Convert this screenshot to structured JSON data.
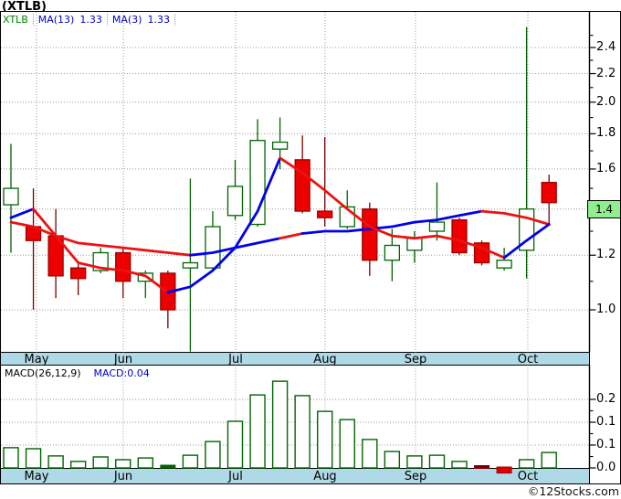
{
  "title": "(XTLB)",
  "legend": {
    "symbol": "XTLB",
    "ma13_label": "MA(13)",
    "ma13_value": "1.33",
    "ma3_label": "MA(3)",
    "ma3_value": "1.33"
  },
  "macd_panel": {
    "label": "MACD(26,12,9)",
    "value_label": "MACD:0.04"
  },
  "price_box_value": "1.4",
  "copyright": "©12Stocks.com",
  "colors": {
    "candle_up_outline": "#006400",
    "candle_down_fill": "#EE0000",
    "candle_down_stroke": "#990000",
    "candle_down_wick": "#7A0000",
    "ma_red": "#EE1111",
    "ma_blue": "#0000EE",
    "strip_blue": "#AFD9E6",
    "legend_blue": "#0000CD",
    "symbol_green": "#008000",
    "price_box_bg": "#90EE90",
    "grid_gray": "#9a9a9a"
  },
  "chart_data": [
    {
      "type": "candlestick",
      "title": "(XTLB) weekly price",
      "months": [
        "May",
        "Jun",
        "Jul",
        "Aug",
        "Sep",
        "Oct"
      ],
      "y_scale": "log",
      "ylim": [
        0.87,
        2.6
      ],
      "price_axis_major_labels": [
        "2.4",
        "2.2",
        "2.0",
        "1.8",
        "1.6",
        "1.2",
        "1.0"
      ],
      "price_axis_major_values": [
        2.4,
        2.2,
        2.0,
        1.8,
        1.6,
        1.2,
        1.0
      ],
      "price_axis_minor_values": [
        1.1,
        1.3,
        1.5,
        1.7,
        1.9,
        2.1,
        2.3,
        2.5
      ],
      "gridline_values": [
        1.0,
        1.2,
        1.4,
        1.6,
        1.8,
        2.0,
        2.2,
        2.4
      ],
      "current_price": 1.4,
      "candles": [
        {
          "o": 1.42,
          "h": 1.74,
          "l": 1.21,
          "c": 1.5
        },
        {
          "o": 1.32,
          "h": 1.5,
          "l": 1.0,
          "c": 1.26
        },
        {
          "o": 1.28,
          "h": 1.4,
          "l": 1.04,
          "c": 1.12
        },
        {
          "o": 1.15,
          "h": 1.17,
          "l": 1.05,
          "c": 1.11
        },
        {
          "o": 1.14,
          "h": 1.23,
          "l": 1.13,
          "c": 1.21
        },
        {
          "o": 1.21,
          "h": 1.23,
          "l": 1.04,
          "c": 1.1
        },
        {
          "o": 1.1,
          "h": 1.14,
          "l": 1.04,
          "c": 1.13
        },
        {
          "o": 1.13,
          "h": 1.14,
          "l": 0.94,
          "c": 1.0
        },
        {
          "o": 1.15,
          "h": 1.55,
          "l": 0.87,
          "c": 1.17
        },
        {
          "o": 1.15,
          "h": 1.39,
          "l": 1.14,
          "c": 1.32
        },
        {
          "o": 1.37,
          "h": 1.65,
          "l": 1.35,
          "c": 1.51
        },
        {
          "o": 1.33,
          "h": 1.89,
          "l": 1.32,
          "c": 1.76
        },
        {
          "o": 1.71,
          "h": 1.9,
          "l": 1.6,
          "c": 1.75
        },
        {
          "o": 1.65,
          "h": 1.79,
          "l": 1.38,
          "c": 1.39
        },
        {
          "o": 1.39,
          "h": 1.78,
          "l": 1.32,
          "c": 1.36
        },
        {
          "o": 1.32,
          "h": 1.49,
          "l": 1.31,
          "c": 1.41
        },
        {
          "o": 1.4,
          "h": 1.43,
          "l": 1.12,
          "c": 1.18
        },
        {
          "o": 1.18,
          "h": 1.31,
          "l": 1.1,
          "c": 1.24
        },
        {
          "o": 1.22,
          "h": 1.3,
          "l": 1.17,
          "c": 1.27
        },
        {
          "o": 1.3,
          "h": 1.53,
          "l": 1.26,
          "c": 1.34
        },
        {
          "o": 1.35,
          "h": 1.36,
          "l": 1.2,
          "c": 1.21
        },
        {
          "o": 1.25,
          "h": 1.26,
          "l": 1.16,
          "c": 1.17
        },
        {
          "o": 1.15,
          "h": 1.23,
          "l": 1.14,
          "c": 1.18
        },
        {
          "o": 1.22,
          "h": 2.57,
          "l": 1.11,
          "c": 1.4
        },
        {
          "o": 1.53,
          "h": 1.57,
          "l": 1.33,
          "c": 1.43
        }
      ],
      "ma_fast": {
        "name": "MA(3)",
        "last_value": 1.33,
        "segments": [
          {
            "color": "blue",
            "points": [
              [
                0,
                1.36
              ],
              [
                1,
                1.4
              ]
            ]
          },
          {
            "color": "red",
            "points": [
              [
                1,
                1.4
              ],
              [
                2,
                1.28
              ],
              [
                3,
                1.17
              ],
              [
                4,
                1.15
              ],
              [
                5,
                1.14
              ],
              [
                6,
                1.12
              ],
              [
                7,
                1.06
              ]
            ]
          },
          {
            "color": "blue",
            "points": [
              [
                7,
                1.06
              ],
              [
                8,
                1.08
              ],
              [
                9,
                1.14
              ],
              [
                10,
                1.23
              ],
              [
                11,
                1.39
              ],
              [
                12,
                1.66
              ]
            ]
          },
          {
            "color": "red",
            "points": [
              [
                12,
                1.66
              ],
              [
                13,
                1.58
              ],
              [
                14,
                1.49
              ],
              [
                15,
                1.4
              ],
              [
                16,
                1.32
              ],
              [
                17,
                1.28
              ],
              [
                18,
                1.27
              ],
              [
                19,
                1.28
              ],
              [
                20,
                1.26
              ],
              [
                21,
                1.23
              ],
              [
                22,
                1.19
              ]
            ]
          },
          {
            "color": "blue",
            "points": [
              [
                22,
                1.19
              ],
              [
                23,
                1.26
              ],
              [
                24,
                1.33
              ]
            ]
          }
        ]
      },
      "ma_slow": {
        "name": "MA(13)",
        "last_value": 1.33,
        "segments": [
          {
            "color": "red",
            "points": [
              [
                0,
                1.34
              ],
              [
                1,
                1.32
              ],
              [
                2,
                1.28
              ],
              [
                3,
                1.25
              ],
              [
                4,
                1.24
              ],
              [
                5,
                1.23
              ],
              [
                6,
                1.22
              ],
              [
                7,
                1.21
              ],
              [
                8,
                1.2
              ]
            ]
          },
          {
            "color": "blue",
            "points": [
              [
                8,
                1.2
              ],
              [
                9,
                1.21
              ],
              [
                10,
                1.23
              ],
              [
                11,
                1.25
              ],
              [
                12,
                1.27
              ]
            ]
          },
          {
            "color": "red",
            "points": [
              [
                12,
                1.27
              ],
              [
                13,
                1.29
              ]
            ]
          },
          {
            "color": "blue",
            "points": [
              [
                13,
                1.29
              ],
              [
                14,
                1.3
              ],
              [
                15,
                1.3
              ],
              [
                16,
                1.31
              ],
              [
                17,
                1.32
              ],
              [
                18,
                1.34
              ],
              [
                19,
                1.35
              ],
              [
                20,
                1.37
              ],
              [
                21,
                1.39
              ]
            ]
          },
          {
            "color": "red",
            "points": [
              [
                21,
                1.39
              ],
              [
                22,
                1.38
              ],
              [
                23,
                1.36
              ],
              [
                24,
                1.33
              ]
            ]
          }
        ]
      }
    },
    {
      "type": "bar",
      "title": "MACD(26,12,9) histogram",
      "last_value": 0.04,
      "axis_tick_labels": [
        "0.2",
        "0.1",
        "0.1",
        "0.0"
      ],
      "axis_tick_values": [
        0.2,
        0.1333,
        0.0667,
        0.0
      ],
      "axis_minor_tick_values": [
        0.0333,
        0.1,
        0.1667
      ],
      "values": [
        {
          "v": 0.059
        },
        {
          "v": 0.056
        },
        {
          "v": 0.035
        },
        {
          "v": 0.019
        },
        {
          "v": 0.032
        },
        {
          "v": 0.024
        },
        {
          "v": 0.029
        },
        {
          "v": 0.004,
          "style": "solid-green"
        },
        {
          "v": 0.037
        },
        {
          "v": 0.077
        },
        {
          "v": 0.136
        },
        {
          "v": 0.213
        },
        {
          "v": 0.253
        },
        {
          "v": 0.211
        },
        {
          "v": 0.165
        },
        {
          "v": 0.141
        },
        {
          "v": 0.083
        },
        {
          "v": 0.048
        },
        {
          "v": 0.035
        },
        {
          "v": 0.037
        },
        {
          "v": 0.019
        },
        {
          "v": 0.004,
          "style": "solid-darkred"
        },
        {
          "v": -0.015,
          "style": "solid-red"
        },
        {
          "v": 0.024
        },
        {
          "v": 0.045
        }
      ]
    }
  ]
}
